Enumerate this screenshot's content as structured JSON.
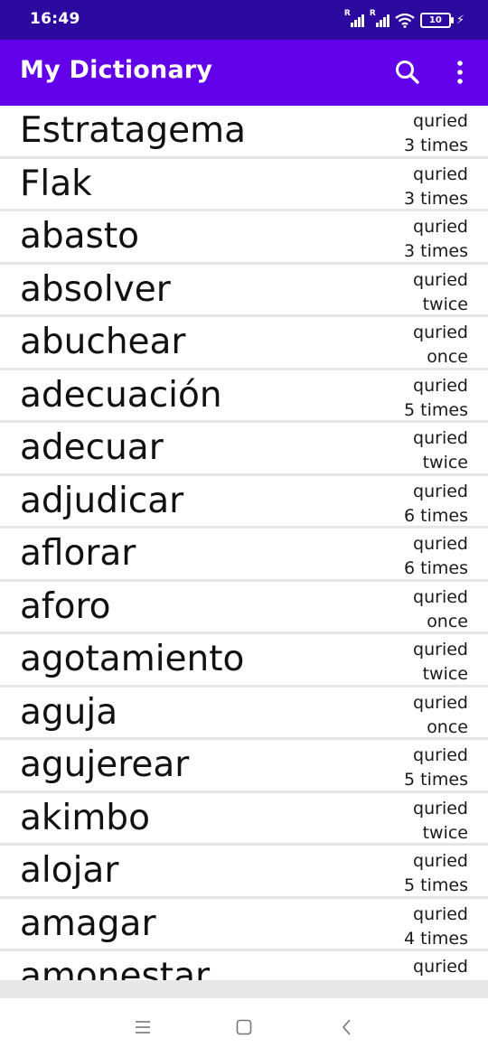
{
  "status": {
    "time": "16:49",
    "battery": "10"
  },
  "app_bar": {
    "title": "My Dictionary",
    "search_icon": "search-icon",
    "more_icon": "more-vert-icon"
  },
  "colors": {
    "status_bar": "#2d0a9f",
    "app_bar": "#6200ea",
    "divider": "#e6e6e6"
  },
  "words": [
    {
      "word": "Estratagema",
      "line1": "quried",
      "line2": "3 times"
    },
    {
      "word": "Flak",
      "line1": "quried",
      "line2": "3 times"
    },
    {
      "word": "abasto",
      "line1": "quried",
      "line2": "3 times"
    },
    {
      "word": "absolver",
      "line1": "quried",
      "line2": "twice"
    },
    {
      "word": "abuchear",
      "line1": "quried",
      "line2": "once"
    },
    {
      "word": "adecuación",
      "line1": "quried",
      "line2": "5 times"
    },
    {
      "word": "adecuar",
      "line1": "quried",
      "line2": "twice"
    },
    {
      "word": "adjudicar",
      "line1": "quried",
      "line2": "6 times"
    },
    {
      "word": "aflorar",
      "line1": "quried",
      "line2": "6 times"
    },
    {
      "word": "aforo",
      "line1": "quried",
      "line2": "once"
    },
    {
      "word": "agotamiento",
      "line1": "quried",
      "line2": "twice"
    },
    {
      "word": "aguja",
      "line1": "quried",
      "line2": "once"
    },
    {
      "word": "agujerear",
      "line1": "quried",
      "line2": "5 times"
    },
    {
      "word": "akimbo",
      "line1": "quried",
      "line2": "twice"
    },
    {
      "word": "alojar",
      "line1": "quried",
      "line2": "5 times"
    },
    {
      "word": "amagar",
      "line1": "quried",
      "line2": "4 times"
    },
    {
      "word": "amonestar",
      "line1": "quried",
      "line2": ""
    }
  ],
  "nav": {
    "menu_icon": "menu-icon",
    "home_icon": "home-square-icon",
    "back_icon": "back-chevron-icon"
  }
}
